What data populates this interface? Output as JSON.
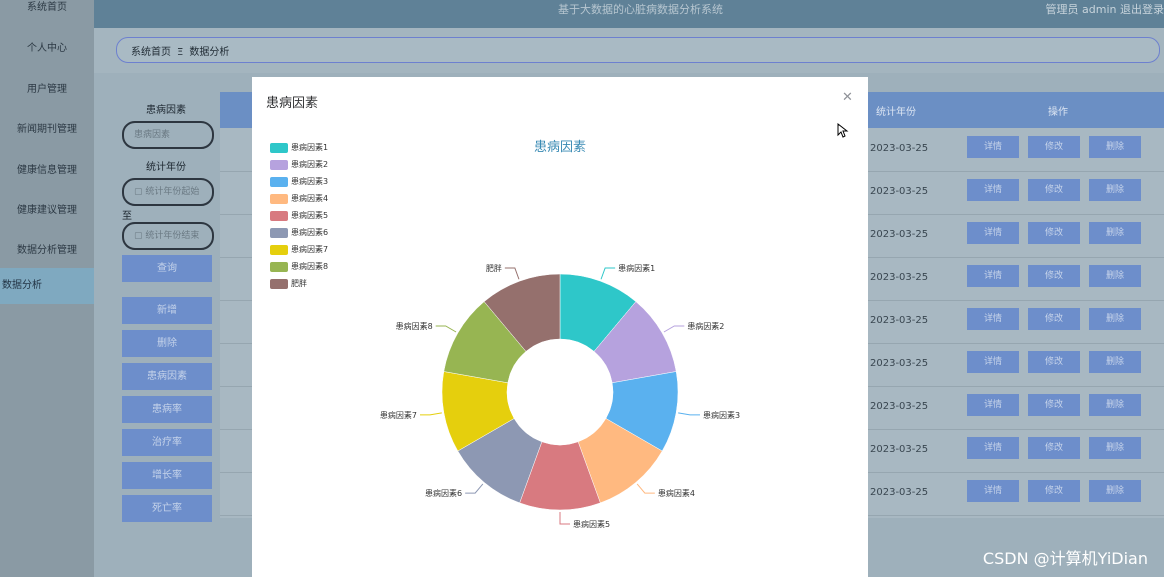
{
  "app": {
    "title": "基于大数据的心脏病数据分析系统",
    "user": "管理员 admin  退出登录"
  },
  "sidebar": {
    "items": [
      "系统首页",
      "个人中心",
      "用户管理",
      "新闻期刊管理",
      "健康信息管理",
      "健康建议管理",
      "数据分析管理",
      "数据分析"
    ]
  },
  "breadcrumb": {
    "home": "系统首页",
    "sep": "Ξ",
    "current": "数据分析"
  },
  "filters": {
    "factor_label": "患病因素",
    "factor_placeholder": "患病因素",
    "year_label": "统计年份",
    "year_start_placeholder": "统计年份起始",
    "to_label": "至",
    "year_end_placeholder": "统计年份结束",
    "query_button": "查询"
  },
  "left_buttons": [
    "新增",
    "删除",
    "患病因素",
    "患病率",
    "治疗率",
    "增长率",
    "死亡率"
  ],
  "table": {
    "headers": {
      "year": "统计年份",
      "actions": "操作"
    },
    "rows": [
      "2023-03-25",
      "2023-03-25",
      "2023-03-25",
      "2023-03-25",
      "2023-03-25",
      "2023-03-25",
      "2023-03-25",
      "2023-03-25",
      "2023-03-25"
    ],
    "action_labels": [
      "详情",
      "修改",
      "删除"
    ]
  },
  "watermark": "CSDN @计算机YiDian",
  "modal": {
    "title": "患病因素",
    "close_icon": "close-icon"
  },
  "chart_data": {
    "type": "pie",
    "variant": "donut",
    "title": "患病因素",
    "legend_position": "top-left",
    "categories": [
      "患病因素1",
      "患病因素2",
      "患病因素3",
      "患病因素4",
      "患病因素5",
      "患病因素6",
      "患病因素7",
      "患病因素8",
      "肥胖"
    ],
    "values": [
      1,
      1,
      1,
      1,
      1,
      1,
      1,
      1,
      1
    ],
    "colors": [
      "#2ec7c9",
      "#b6a2de",
      "#5ab1ef",
      "#ffb980",
      "#d87a80",
      "#8d98b3",
      "#e5cf0d",
      "#97b552",
      "#95706d"
    ]
  }
}
